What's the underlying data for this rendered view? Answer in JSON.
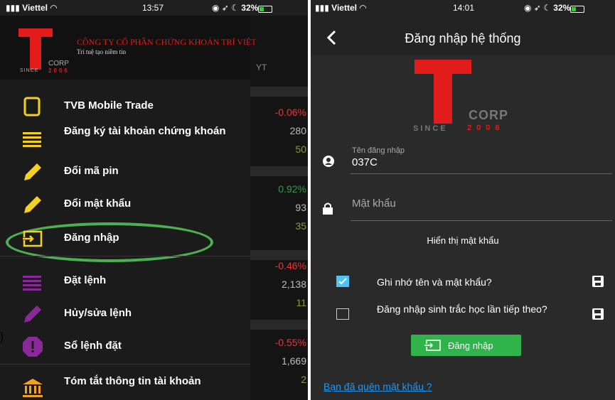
{
  "left": {
    "status": {
      "carrier": "Viettel",
      "time": "13:57",
      "battery": "32%"
    },
    "logo": {
      "company": "CÔNG TY CỔ PHẦN CHỨNG KHOÁN TRÍ VIỆT",
      "slogan": "Trí tuệ tạo niềm tin",
      "corp": "CORP",
      "since": "SINCE",
      "year": "2006"
    },
    "menu": [
      {
        "label": "TVB Mobile Trade",
        "icon": "phone-outline-icon"
      },
      {
        "label": "Đăng ký tài khoản chứng khoán",
        "icon": "list-lines-icon"
      },
      {
        "label": "Đổi mã pin",
        "icon": "pencil-icon"
      },
      {
        "label": "Đổi mật khẩu",
        "icon": "pencil-icon"
      },
      {
        "label": "Đăng nhập",
        "icon": "login-icon"
      },
      {
        "label": "Đặt lệnh",
        "icon": "list-lines-icon"
      },
      {
        "label": "Hủy/sửa lệnh",
        "icon": "pencil-icon"
      },
      {
        "label": "Sổ lệnh đặt",
        "icon": "alert-octagon-icon"
      },
      {
        "label": "Tóm tắt thông tin tài khoản",
        "icon": "bank-icon"
      }
    ],
    "market": {
      "header": "YT",
      "rows": [
        {
          "text": "-0.06%",
          "color": "#e53935"
        },
        {
          "text": "280",
          "color": "#bbbbbb"
        },
        {
          "text": "50",
          "color": "#8a9a3a"
        },
        {
          "text": "0.92%",
          "color": "#3a9a4a"
        },
        {
          "text": "93",
          "color": "#bbbbbb"
        },
        {
          "text": "35",
          "color": "#8a9a3a"
        },
        {
          "text": "-0.46%",
          "color": "#e53935"
        },
        {
          "text": "2,138",
          "color": "#bbbbbb"
        },
        {
          "text": "11",
          "color": "#8a9a3a"
        },
        {
          "text": "-0.55%",
          "color": "#e53935"
        },
        {
          "text": "1,669",
          "color": "#bbbbbb"
        },
        {
          "text": "2",
          "color": "#8a9a3a"
        }
      ]
    }
  },
  "right": {
    "status": {
      "carrier": "Viettel",
      "time": "14:01",
      "battery": "32%"
    },
    "title": "Đăng nhập hệ thống",
    "logo": {
      "corp": "CORP",
      "since": "SINCE",
      "year": "2006"
    },
    "username": {
      "label": "Tên đăng nhập",
      "value": "037C"
    },
    "password": {
      "placeholder": "Mật khẩu"
    },
    "show_password": "Hiển thị mật khẩu",
    "remember": {
      "label": "Ghi nhớ tên và mật khẩu?",
      "checked": true
    },
    "biometric": {
      "label": "Đăng nhập sinh trắc học lần tiếp theo?",
      "checked": false
    },
    "login_button": "Đăng nhập",
    "forgot": "Bạn đã quên mật khẩu ?"
  },
  "colors": {
    "accent_yellow": "#f5d020",
    "accent_purple": "#8a2a9a",
    "brand_red": "#e21b1b",
    "button_green": "#2fb34a",
    "check_blue": "#4fc3f7",
    "highlight_green": "#4caf50",
    "link_blue": "#2196f3"
  }
}
